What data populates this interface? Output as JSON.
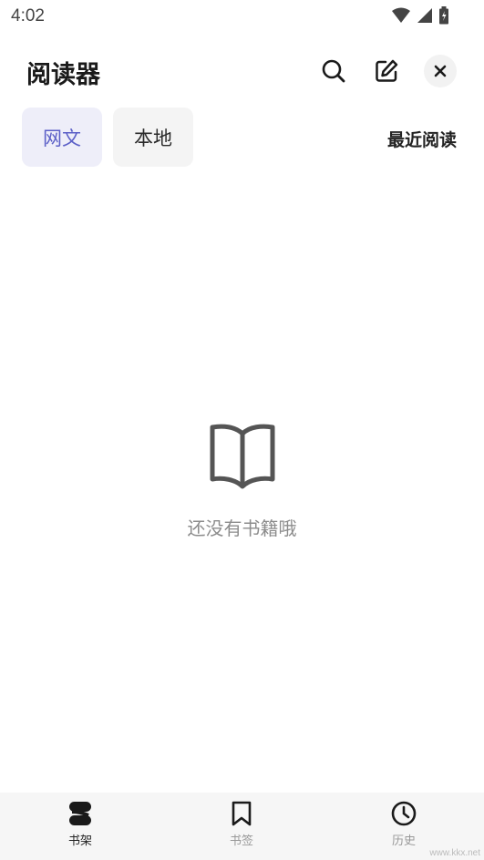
{
  "status_bar": {
    "time": "4:02"
  },
  "header": {
    "title": "阅读器"
  },
  "tabs": [
    {
      "label": "网文",
      "active": true
    },
    {
      "label": "本地",
      "active": false
    }
  ],
  "recent_label": "最近阅读",
  "empty_state": {
    "message": "还没有书籍哦",
    "icon": "open-book-icon"
  },
  "bottom_nav": [
    {
      "label": "书架",
      "icon": "bookshelf-icon",
      "active": true
    },
    {
      "label": "书签",
      "icon": "bookmark-icon",
      "active": false
    },
    {
      "label": "历史",
      "icon": "clock-icon",
      "active": false
    }
  ],
  "watermark": "www.kkx.net",
  "colors": {
    "accent": "#5b5fc7",
    "accent_bg": "#eeeef9",
    "muted_text": "#8c8c8c"
  }
}
